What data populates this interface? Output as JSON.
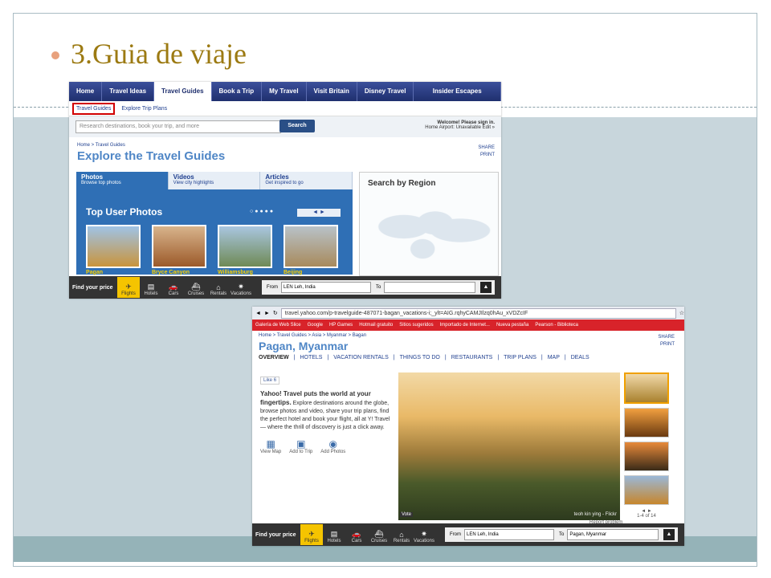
{
  "slide": {
    "title": "3.Guia de viaje"
  },
  "shot1": {
    "nav": [
      "Home",
      "Travel Ideas",
      "Travel Guides",
      "Book a Trip",
      "My Travel",
      "Visit Britain",
      "Disney Travel",
      "Insider Escapes"
    ],
    "subnav_highlighted": "Travel Guides",
    "subnav_other": "Explore Trip Plans",
    "search_placeholder": "Research destinations, book your trip, and more",
    "search_button": "Search",
    "signin_line1": "Welcome! Please sign in.",
    "signin_line2": "Home Airport: Unavailable  Edit »",
    "breadcrumb": "Home > Travel Guides",
    "heading": "Explore the Travel Guides",
    "share": "SHARE",
    "print": "PRINT",
    "tabs": [
      {
        "title": "Photos",
        "sub": "Browse top photos"
      },
      {
        "title": "Videos",
        "sub": "View city highlights"
      },
      {
        "title": "Articles",
        "sub": "Get inspired to go"
      }
    ],
    "panel_title": "Top User Photos",
    "dots": "○●●●●",
    "arrows": "◄   ►",
    "photos": [
      {
        "caption": "Pagan",
        "color": "#c9943c"
      },
      {
        "caption": "Bryce Canyon",
        "color": "#9c5a2a"
      },
      {
        "caption": "Williamsburg",
        "color": "#6f8a55"
      },
      {
        "caption": "Beijing",
        "color": "#a88a5c"
      }
    ],
    "region_title": "Search by Region",
    "findbar": {
      "label": "Find your price",
      "items": [
        {
          "label": "Flights",
          "icon": "✈"
        },
        {
          "label": "Hotels",
          "icon": "▤"
        },
        {
          "label": "Cars",
          "icon": "🚗"
        },
        {
          "label": "Cruises",
          "icon": "⛴"
        },
        {
          "label": "Rentals",
          "icon": "⌂"
        },
        {
          "label": "Vacations",
          "icon": "✷"
        }
      ],
      "from_label": "From",
      "from_value": "LEN  Leh, India",
      "to_label": "To",
      "to_value": ""
    }
  },
  "shot2": {
    "url": "travel.yahoo.com/p-travelguide-487071-bagan_vacations-i;_ylt=AIG.rqhyCAMJIlzq0hAu_xVDZcIF",
    "bookmarks": [
      "Galería de Web Slice",
      "Google",
      "HP Games",
      "Hotmail gratuito",
      "Sitios sugeridos",
      "Importado de Internet...",
      "Nueva pestaña",
      "Pearson - Biblioteca"
    ],
    "breadcrumb": "Home > Travel Guides > Asia > Myanmar > Bagan",
    "heading": "Pagan, Myanmar",
    "share": "SHARE",
    "print": "PRINT",
    "subtabs": [
      "OVERVIEW",
      "HOTELS",
      "VACATION RENTALS",
      "THINGS TO DO",
      "RESTAURANTS",
      "TRIP PLANS",
      "MAP",
      "DEALS"
    ],
    "like_label": "Like",
    "like_count": "6",
    "desc_bold": "Yahoo! Travel puts the world at your fingertips.",
    "desc": "Explore destinations around the globe, browse photos and video, share your trip plans, find the perfect hotel and book your flight, all at Y! Travel — where the thrill of discovery is just a click away.",
    "actions": [
      "View Map",
      "Add to Trip",
      "Add Photos"
    ],
    "vote": "Vote",
    "credit": "teoh kin ying - Flickr",
    "pager": "1-4 of 14",
    "report": "Report problem",
    "findbar": {
      "label": "Find your price",
      "items": [
        {
          "label": "Flights",
          "icon": "✈"
        },
        {
          "label": "Hotels",
          "icon": "▤"
        },
        {
          "label": "Cars",
          "icon": "🚗"
        },
        {
          "label": "Cruises",
          "icon": "⛴"
        },
        {
          "label": "Rentals",
          "icon": "⌂"
        },
        {
          "label": "Vacations",
          "icon": "✷"
        }
      ],
      "from_label": "From",
      "from_value": "LEN  Leh, India",
      "to_label": "To",
      "to_value": "Pagan, Myanmar"
    }
  }
}
